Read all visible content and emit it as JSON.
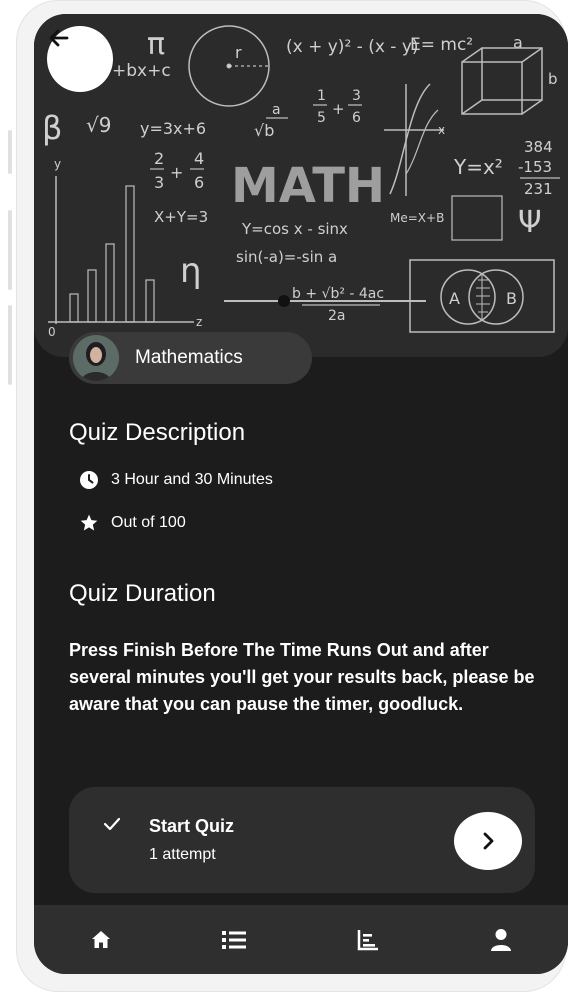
{
  "hero": {
    "title": "MATH",
    "formulas": [
      "π",
      "(x + y)² - (x - y)",
      "E= mc²",
      "a",
      "+bx+c",
      "r",
      "β",
      "√9",
      "y=3x+6",
      "a",
      "√b",
      "1",
      "5",
      "+",
      "3",
      "6",
      "2",
      "3",
      "+",
      "4",
      "6",
      "Y=x²",
      "384",
      "-153",
      "231",
      "X+Y=3",
      "Y=cos x - sinx",
      "Me=X+B",
      "Ψ",
      "sin(-a)=-sin a",
      "η",
      "b + √b² - 4ac",
      "2a",
      "A",
      "B",
      "z",
      "0",
      "y",
      "x",
      "b"
    ]
  },
  "subject": {
    "label": "Mathematics"
  },
  "quiz_description": {
    "title": "Quiz Description",
    "duration": "3 Hour and 30 Minutes",
    "score": "Out of 100"
  },
  "quiz_duration": {
    "title": "Quiz Duration",
    "text": "Press Finish Before The Time Runs Out and after several minutes you'll get your results back, please be aware that you can pause the timer, goodluck."
  },
  "start": {
    "title": "Start Quiz",
    "subtitle": "1 attempt"
  },
  "nav": {
    "items": [
      "home-icon",
      "list-icon",
      "chart-icon",
      "profile-icon"
    ]
  },
  "colors": {
    "background": "#1c1c1c",
    "hero": "#2b2b2b",
    "card": "#2e2e2e",
    "nav": "#2f2f2f",
    "text": "#ffffff"
  }
}
